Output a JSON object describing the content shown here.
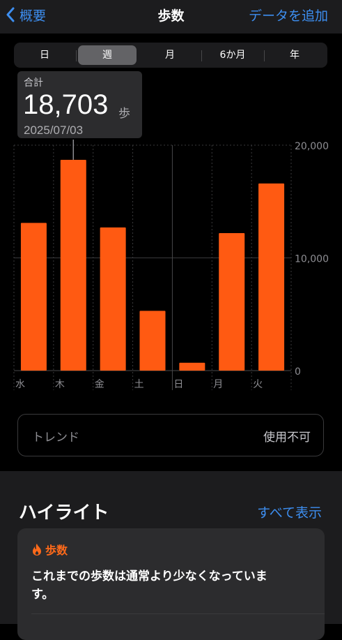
{
  "nav": {
    "back_label": "概要",
    "title": "歩数",
    "add_label": "データを追加"
  },
  "segments": [
    "日",
    "週",
    "月",
    "6か月",
    "年"
  ],
  "active_segment": "週",
  "selection": {
    "label": "合計",
    "value": "18,703",
    "unit": "歩",
    "date": "2025/07/03"
  },
  "chart_data": {
    "type": "bar",
    "categories": [
      "水",
      "木",
      "金",
      "土",
      "日",
      "月",
      "火"
    ],
    "values": [
      13100,
      18703,
      12700,
      5300,
      700,
      12200,
      16600
    ],
    "ylim": [
      0,
      20000
    ],
    "yticks": [
      "0",
      "10,000",
      "20,000"
    ],
    "selected_category": "木",
    "bar_color": "#ff5a12"
  },
  "trend": {
    "label": "トレンド",
    "value": "使用不可"
  },
  "highlights": {
    "title": "ハイライト",
    "show_all": "すべて表示",
    "card": {
      "category": "歩数",
      "icon": "flame-icon",
      "text": "これまでの歩数は通常より少なくなっています。"
    }
  },
  "colors": {
    "accent": "#3d8ef0",
    "bar": "#ff5a12",
    "highlight": "#ff6a1a"
  }
}
